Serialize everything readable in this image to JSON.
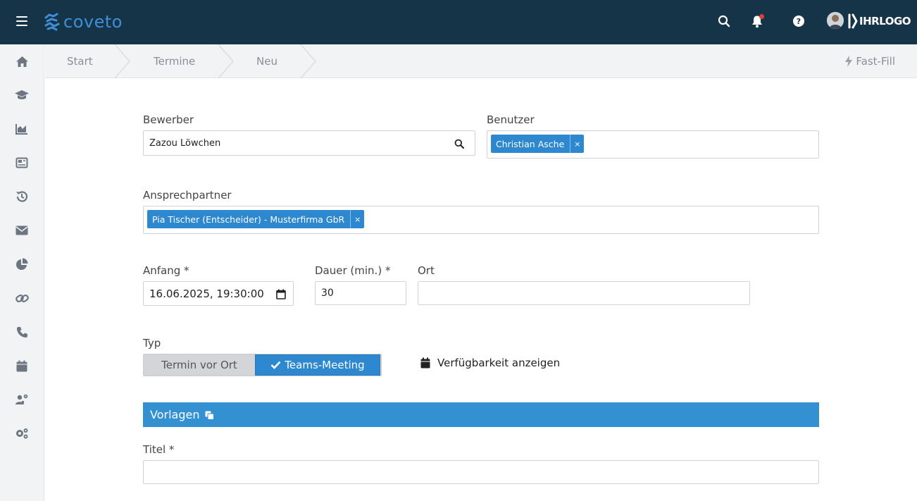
{
  "app": {
    "brand": "coveto",
    "logo_text": "IHRLOGO"
  },
  "colors": {
    "topbar": "#163447",
    "accent": "#2e88cf",
    "section": "#3391d2",
    "badge": "#e23b3b"
  },
  "icons": {
    "topbar": [
      "menu-icon",
      "search-icon",
      "bell-icon",
      "help-icon"
    ],
    "sidebar": [
      "home-icon",
      "graduation-cap-icon",
      "area-chart-icon",
      "newspaper-icon",
      "history-icon",
      "envelope-icon",
      "pie-chart-icon",
      "link-icon",
      "phone-icon",
      "calendar-icon",
      "user-cog-icon",
      "cogs-icon"
    ]
  },
  "breadcrumb": [
    "Start",
    "Termine",
    "Neu"
  ],
  "fastfill": "Fast-Fill",
  "form": {
    "bewerber": {
      "label": "Bewerber",
      "value": "Zazou Löwchen"
    },
    "benutzer": {
      "label": "Benutzer",
      "tags": [
        "Christian Asche"
      ]
    },
    "ansprechpartner": {
      "label": "Ansprechpartner",
      "tags": [
        "Pia Tischer (Entscheider) - Musterfirma GbR"
      ]
    },
    "anfang": {
      "label": "Anfang *",
      "value": "16.06.2025, 19:30:00"
    },
    "dauer": {
      "label": "Dauer (min.) *",
      "value": "30"
    },
    "ort": {
      "label": "Ort",
      "value": ""
    },
    "typ": {
      "label": "Typ",
      "options": [
        "Termin vor Ort",
        "Teams-Meeting"
      ],
      "selected": "Teams-Meeting"
    },
    "availability": "Verfügbarkeit anzeigen",
    "vorlagen": "Vorlagen",
    "titel": {
      "label": "Titel *",
      "value": ""
    }
  },
  "tag_remove": "×"
}
